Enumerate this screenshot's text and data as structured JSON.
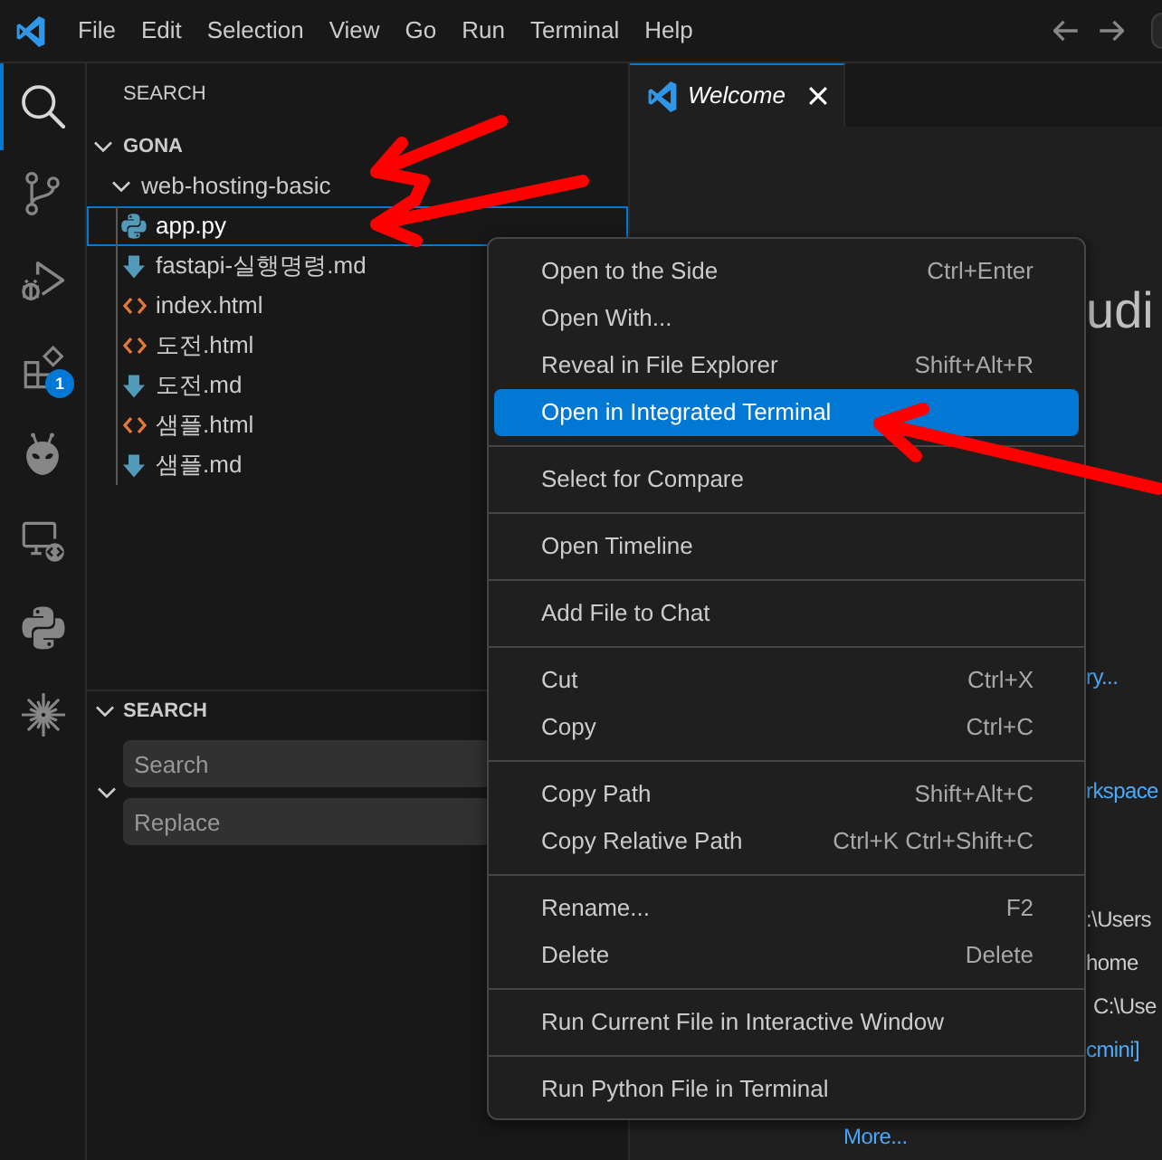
{
  "title_bar": {
    "menu": [
      "File",
      "Edit",
      "Selection",
      "View",
      "Go",
      "Run",
      "Terminal",
      "Help"
    ]
  },
  "activity_bar": [
    {
      "kind": "search",
      "selected": true
    },
    {
      "kind": "source-control",
      "selected": false
    },
    {
      "kind": "run-debug",
      "selected": false
    },
    {
      "kind": "extensions",
      "selected": false,
      "badge": "1"
    },
    {
      "kind": "alien",
      "selected": false
    },
    {
      "kind": "remote",
      "selected": false
    },
    {
      "kind": "python",
      "selected": false
    },
    {
      "kind": "sparkle",
      "selected": false
    }
  ],
  "sidebar": {
    "title": "SEARCH",
    "tree": [
      {
        "label": "GONA",
        "kind": "root",
        "expanded": true,
        "selected": false,
        "children": [
          {
            "label": "web-hosting-basic",
            "kind": "folder",
            "expanded": true,
            "selected": false,
            "children": [
              {
                "label": "app.py",
                "kind": "python",
                "selected": true
              },
              {
                "label": "fastapi-실행명령.md",
                "kind": "markdown",
                "selected": false
              },
              {
                "label": "index.html",
                "kind": "html",
                "selected": false
              },
              {
                "label": "도전.html",
                "kind": "html",
                "selected": false
              },
              {
                "label": "도전.md",
                "kind": "markdown",
                "selected": false
              },
              {
                "label": "샘플.html",
                "kind": "html",
                "selected": false
              },
              {
                "label": "샘플.md",
                "kind": "markdown",
                "selected": false
              }
            ]
          }
        ]
      }
    ],
    "search_panel": {
      "title": "SEARCH",
      "expanded": true,
      "replace_expanded": true,
      "search": {
        "placeholder": "Search"
      },
      "replace": {
        "placeholder": "Replace"
      }
    }
  },
  "editor": {
    "tabs": [
      {
        "label": "Welcome",
        "selected": true
      }
    ],
    "welcome": {
      "title_fragment": "udi",
      "lines": [
        {
          "kind": "link",
          "text": "ry..."
        },
        {
          "kind": "link",
          "text": "rkspace"
        },
        {
          "kind": "text",
          "text": ":\\Users"
        },
        {
          "kind": "text",
          "text": "home"
        },
        {
          "kind": "text",
          "text": "C:\\Use"
        },
        {
          "kind": "link",
          "text": "cmini]"
        },
        {
          "kind": "link",
          "text": "More..."
        }
      ]
    }
  },
  "context_menu": {
    "groups": [
      {
        "items": [
          {
            "label": "Open to the Side",
            "shortcut": "Ctrl+Enter",
            "selected": false
          },
          {
            "label": "Open With...",
            "selected": false
          },
          {
            "label": "Reveal in File Explorer",
            "shortcut": "Shift+Alt+R",
            "selected": false
          },
          {
            "label": "Open in Integrated Terminal",
            "selected": true
          }
        ]
      },
      {
        "items": [
          {
            "label": "Select for Compare",
            "selected": false
          }
        ]
      },
      {
        "items": [
          {
            "label": "Open Timeline",
            "selected": false
          }
        ]
      },
      {
        "items": [
          {
            "label": "Add File to Chat",
            "selected": false
          }
        ]
      },
      {
        "items": [
          {
            "label": "Cut",
            "shortcut": "Ctrl+X",
            "selected": false
          },
          {
            "label": "Copy",
            "shortcut": "Ctrl+C",
            "selected": false
          }
        ]
      },
      {
        "items": [
          {
            "label": "Copy Path",
            "shortcut": "Shift+Alt+C",
            "selected": false
          },
          {
            "label": "Copy Relative Path",
            "shortcut": "Ctrl+K Ctrl+Shift+C",
            "selected": false
          }
        ]
      },
      {
        "items": [
          {
            "label": "Rename...",
            "shortcut": "F2",
            "selected": false
          },
          {
            "label": "Delete",
            "shortcut": "Delete",
            "selected": false
          }
        ]
      },
      {
        "items": [
          {
            "label": "Run Current File in Interactive Window",
            "selected": false
          }
        ]
      },
      {
        "items": [
          {
            "label": "Run Python File in Terminal",
            "selected": false
          }
        ]
      }
    ]
  }
}
